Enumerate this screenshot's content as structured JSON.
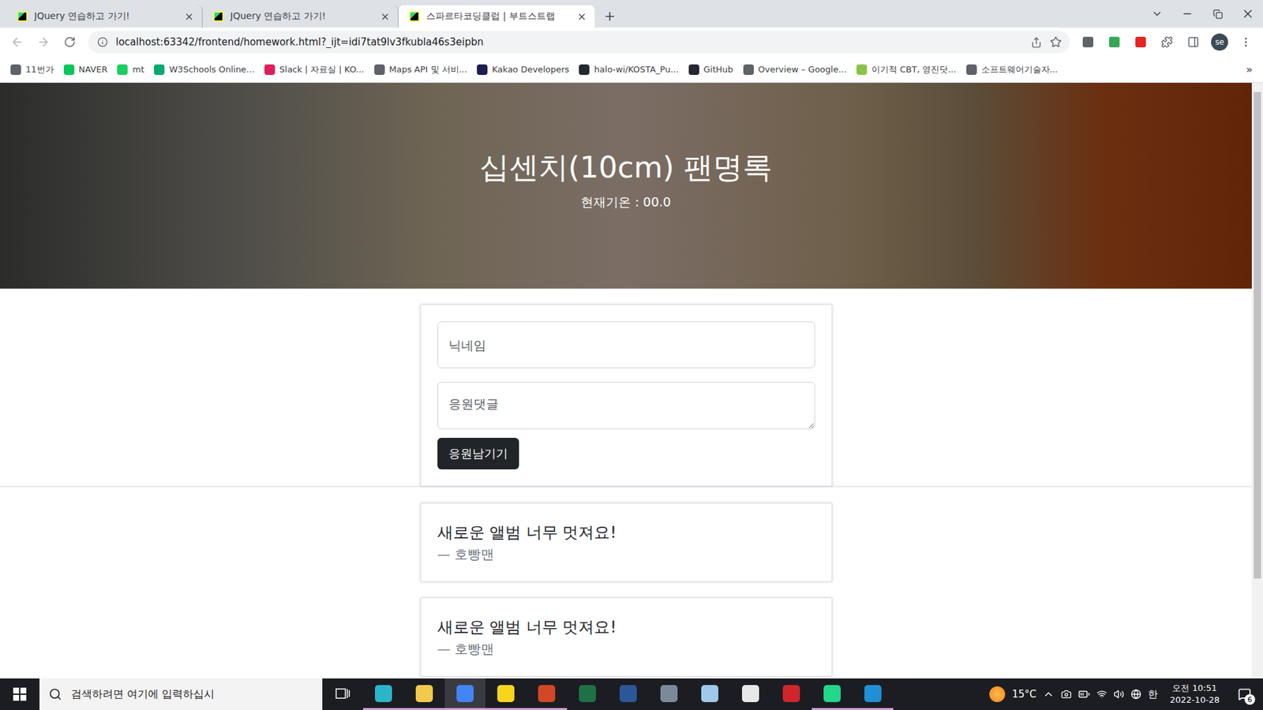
{
  "browser": {
    "tabs": [
      {
        "label": "JQuery 연습하고 가기!",
        "selected": false
      },
      {
        "label": "JQuery 연습하고 가기!",
        "selected": false
      },
      {
        "label": "스파르타코딩클럽 | 부트스트랩",
        "selected": true
      }
    ],
    "address": "localhost:63342/frontend/homework.html?_ijt=idi7tat9lv3fkubla46s3eipbn",
    "profile": "se",
    "bookmarks": [
      {
        "label": "11번가",
        "color": "#5f6368"
      },
      {
        "label": "NAVER",
        "color": "#03c75a"
      },
      {
        "label": "mt",
        "color": "#19ce60"
      },
      {
        "label": "W3Schools Online...",
        "color": "#04aa6d"
      },
      {
        "label": "Slack | 자료실 | KO...",
        "color": "#e01e5a"
      },
      {
        "label": "Maps API 및 서비...",
        "color": "#5f6368"
      },
      {
        "label": "Kakao Developers",
        "color": "#1d1d50"
      },
      {
        "label": "halo-wi/KOSTA_Pu...",
        "color": "#24292f"
      },
      {
        "label": "GitHub",
        "color": "#24292f"
      },
      {
        "label": "Overview – Google...",
        "color": "#5f6368"
      },
      {
        "label": "이기적 CBT, 영진닷...",
        "color": "#8bc34a"
      },
      {
        "label": "소프트웨어기술자...",
        "color": "#5f6368"
      }
    ],
    "bookmarks_more": "»"
  },
  "page": {
    "title": "십센치(10cm) 팬명록",
    "temperature": "현재기온 : 00.0",
    "form": {
      "nickname_placeholder": "닉네임",
      "comment_placeholder": "응원댓글",
      "button": "응원남기기"
    },
    "comments": [
      {
        "text": "새로운 앨범 너무 멋져요!",
        "author": "— 호빵맨"
      },
      {
        "text": "새로운 앨범 너무 멋져요!",
        "author": "— 호빵맨"
      }
    ]
  },
  "taskbar": {
    "search_placeholder": "검색하려면 여기에 입력하십시",
    "apps": [
      {
        "color": "#2bb5c8",
        "running": true,
        "selected": false
      },
      {
        "color": "#f2c94c",
        "running": true,
        "selected": false
      },
      {
        "color": "#4285f4",
        "running": true,
        "selected": true
      },
      {
        "color": "#f7d51d",
        "running": true,
        "selected": false
      },
      {
        "color": "#d24726",
        "running": true,
        "selected": false
      },
      {
        "color": "#1e7145",
        "running": false,
        "selected": false
      },
      {
        "color": "#2b579a",
        "running": false,
        "selected": false
      },
      {
        "color": "#7a8a99",
        "running": false,
        "selected": false
      },
      {
        "color": "#9ec9e8",
        "running": false,
        "selected": false
      },
      {
        "color": "#e8e8e8",
        "running": false,
        "selected": false
      },
      {
        "color": "#d0252d",
        "running": false,
        "selected": false
      },
      {
        "color": "#21d789",
        "running": true,
        "selected": false
      },
      {
        "color": "#1f8fd6",
        "running": true,
        "selected": false
      }
    ],
    "weather": "15°C",
    "ime": "한",
    "time": "오전 10:51",
    "date": "2022-10-28",
    "notifications": "6"
  }
}
